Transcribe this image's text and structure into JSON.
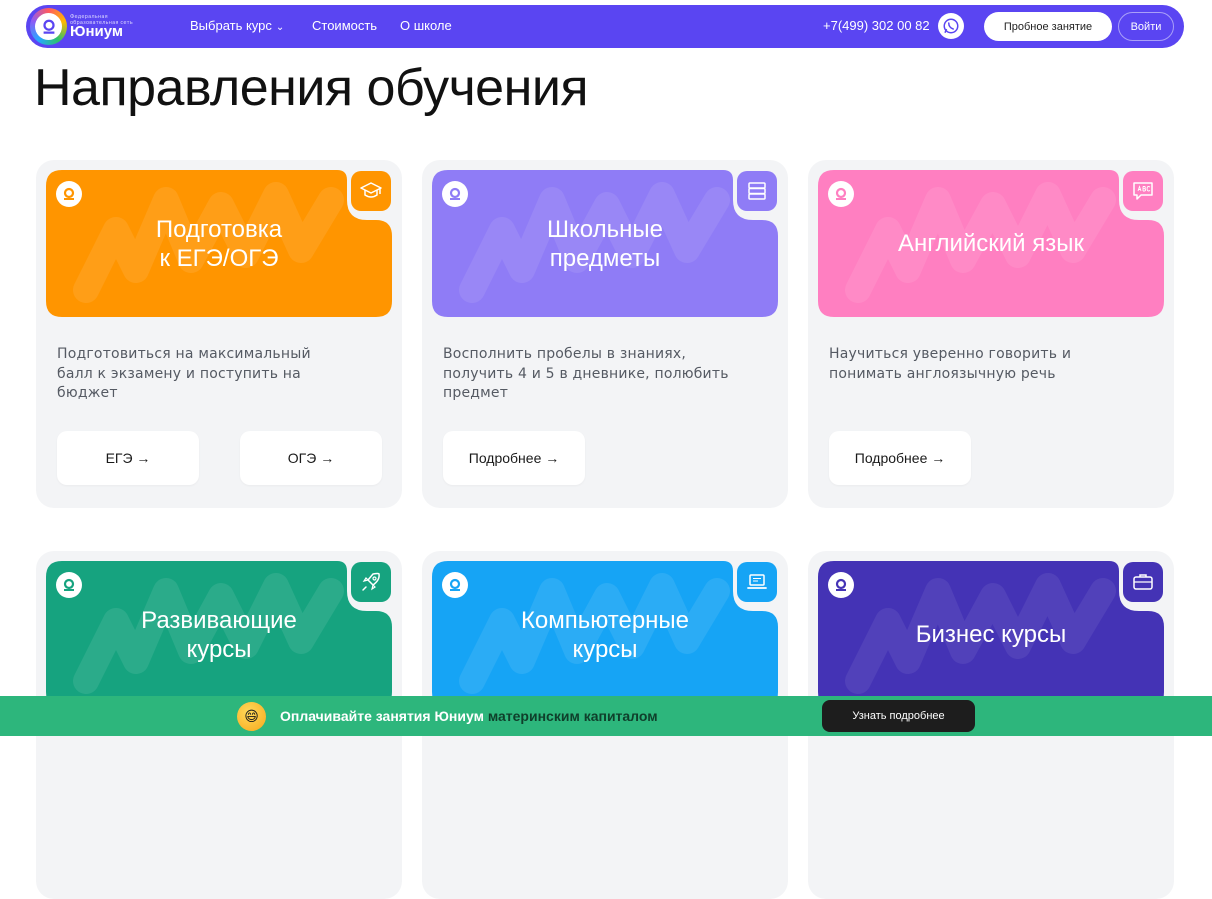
{
  "header": {
    "brand_small": "Федеральная образовательная сеть",
    "brand": "Юниум",
    "nav": [
      {
        "label": "Выбрать курс"
      },
      {
        "label": "Стоимость"
      },
      {
        "label": "О школе"
      }
    ],
    "phone": "+7(499) 302 00 82",
    "trial_button": "Пробное занятие",
    "login_button": "Войти"
  },
  "page_title": "Направления обучения",
  "cards": [
    {
      "title": "Подготовка\nк ЕГЭ/ОГЭ",
      "color": "#ff9500",
      "icon": "graduation-cap-icon",
      "description": "Подготовиться на максимальный балл к экзамену и поступить на бюджет",
      "buttons": [
        "ЕГЭ →",
        "ОГЭ →"
      ]
    },
    {
      "title": "Школьные\nпредметы",
      "color": "#8f7cf6",
      "icon": "books-icon",
      "description": "Восполнить пробелы в знаниях, получить 4 и 5 в дневнике, полюбить предмет",
      "buttons": [
        "Подробнее →"
      ]
    },
    {
      "title": "Английский язык",
      "color": "#ff7fc1",
      "icon": "abc-chat-icon",
      "description": "Научиться уверенно говорить и понимать англоязычную речь",
      "buttons": [
        "Подробнее →"
      ]
    },
    {
      "title": "Развивающие\nкурсы",
      "color": "#16a37f",
      "icon": "rocket-icon"
    },
    {
      "title": "Компьютерные\nкурсы",
      "color": "#16a4f5",
      "icon": "laptop-icon"
    },
    {
      "title": "Бизнес курсы",
      "color": "#4433b5",
      "icon": "briefcase-icon"
    }
  ],
  "promo": {
    "text": "Оплачивайте занятия Юниум",
    "highlight": "материнским капиталом",
    "button": "Узнать подробнее",
    "emoji": "😄"
  }
}
